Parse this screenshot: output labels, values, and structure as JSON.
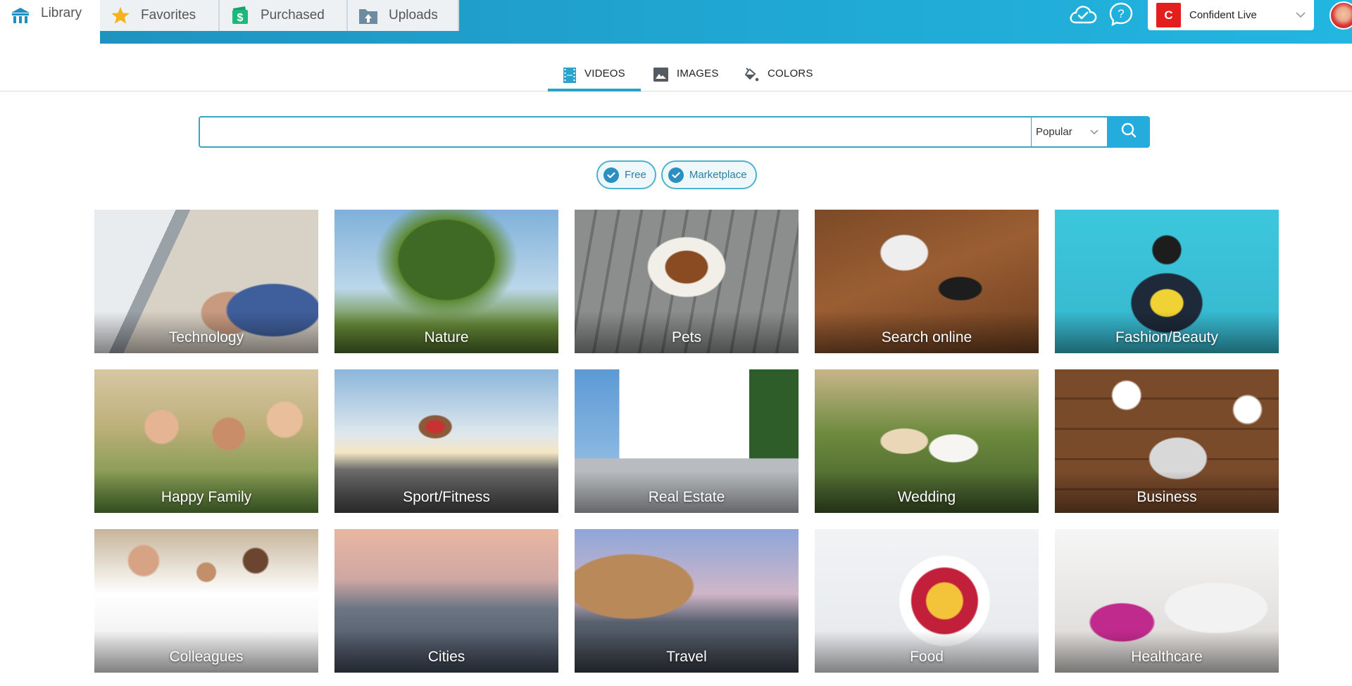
{
  "header": {
    "tabs": [
      {
        "label": "Library",
        "icon": "library-icon",
        "active": true
      },
      {
        "label": "Favorites",
        "icon": "star-icon",
        "active": false
      },
      {
        "label": "Purchased",
        "icon": "wallet-dollar-icon",
        "active": false
      },
      {
        "label": "Uploads",
        "icon": "folder-upload-icon",
        "active": false
      }
    ],
    "cloud_icon": "cloud-check-icon",
    "help_icon": "help-icon",
    "account": {
      "badge_letter": "C",
      "name": "Confident Live",
      "badge_color": "#e41d1d"
    },
    "avatar_icon": "user-avatar"
  },
  "media_tabs": [
    {
      "label": "VIDEOS",
      "icon": "film-icon",
      "active": true
    },
    {
      "label": "IMAGES",
      "icon": "image-icon",
      "active": false
    },
    {
      "label": "COLORS",
      "icon": "paint-bucket-icon",
      "active": false
    }
  ],
  "search": {
    "value": "",
    "placeholder": "",
    "sort_selected": "Popular",
    "button_icon": "search-icon"
  },
  "filters": [
    {
      "label": "Free",
      "checked": true
    },
    {
      "label": "Marketplace",
      "checked": true
    }
  ],
  "categories": [
    {
      "label": "Technology",
      "key": "technology"
    },
    {
      "label": "Nature",
      "key": "nature"
    },
    {
      "label": "Pets",
      "key": "pets"
    },
    {
      "label": "Search online",
      "key": "search"
    },
    {
      "label": "Fashion/Beauty",
      "key": "fashion"
    },
    {
      "label": "Happy Family",
      "key": "family"
    },
    {
      "label": "Sport/Fitness",
      "key": "sport"
    },
    {
      "label": "Real Estate",
      "key": "realestate"
    },
    {
      "label": "Wedding",
      "key": "wedding"
    },
    {
      "label": "Business",
      "key": "business"
    },
    {
      "label": "Colleagues",
      "key": "colleagues"
    },
    {
      "label": "Cities",
      "key": "cities"
    },
    {
      "label": "Travel",
      "key": "travel"
    },
    {
      "label": "Food",
      "key": "food"
    },
    {
      "label": "Healthcare",
      "key": "healthcare"
    }
  ],
  "colors": {
    "accent": "#23acdc",
    "header_blue": "#20a6d2",
    "active_tab_underline": "#27a2c8",
    "chip_text": "#2b7fa3"
  }
}
